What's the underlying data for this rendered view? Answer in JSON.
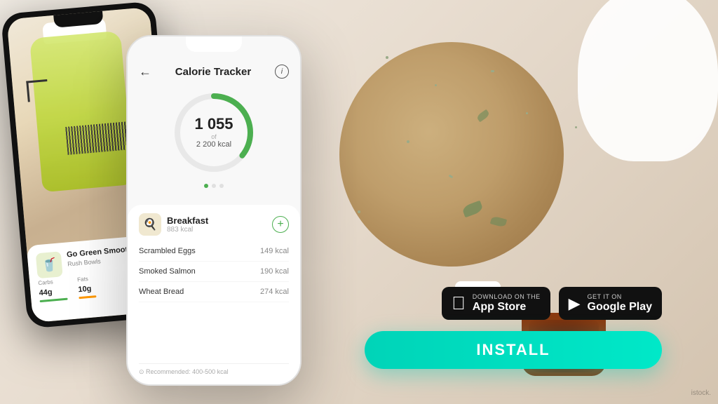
{
  "app": {
    "title": "Calorie Tracker",
    "back_icon": "←",
    "info_icon": "i"
  },
  "calorie": {
    "current": "1 055",
    "of_label": "of",
    "max": "2 200 kcal"
  },
  "meals": {
    "breakfast_label": "Breakfast",
    "breakfast_kcal": "883 kcal",
    "items": [
      {
        "name": "Scrambled Eggs",
        "kcal": "149 kcal"
      },
      {
        "name": "Smoked Salmon",
        "kcal": "190 kcal"
      },
      {
        "name": "Wheat Bread",
        "kcal": "274 kcal"
      }
    ],
    "recommended": "⊙ Recommended: 400-500 kcal"
  },
  "product": {
    "name": "Go Green Smoothie",
    "brand": "Rush Bowls",
    "carbs_label": "Carbs",
    "carbs_value": "44g",
    "fats_label": "Fats",
    "fats_value": "10g"
  },
  "store": {
    "apple_top": "Download on the",
    "apple_main": "App Store",
    "google_top": "GET IT ON",
    "google_main": "Google Play"
  },
  "install": {
    "label": "INSTALL"
  },
  "watermark": "istock."
}
